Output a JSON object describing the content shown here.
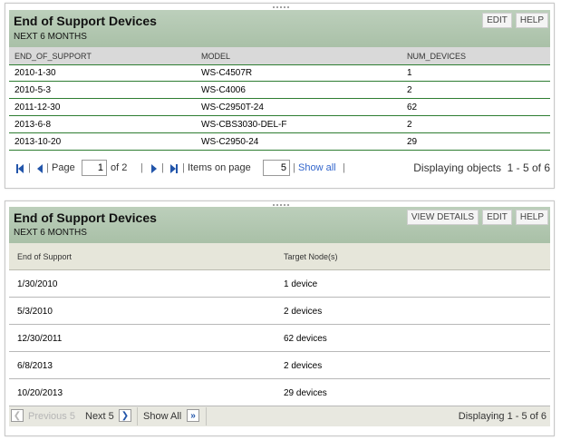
{
  "panel1": {
    "title": "End of Support Devices",
    "subtitle": "NEXT 6 MONTHS",
    "buttons": {
      "edit": "EDIT",
      "help": "HELP"
    },
    "columns": [
      "END_OF_SUPPORT",
      "MODEL",
      "NUM_DEVICES"
    ],
    "rows": [
      [
        "2010-1-30",
        "WS-C4507R",
        "1"
      ],
      [
        "2010-5-3",
        "WS-C4006",
        "2"
      ],
      [
        "2011-12-30",
        "WS-C2950T-24",
        "62"
      ],
      [
        "2013-6-8",
        "WS-CBS3030-DEL-F",
        "2"
      ],
      [
        "2013-10-20",
        "WS-C2950-24",
        "29"
      ]
    ],
    "pager": {
      "page_label": "Page",
      "page_value": "1",
      "of_label": "of 2",
      "items_label": "Items on page",
      "items_value": "5",
      "show_all": "Show all",
      "display_text": "Displaying objects  1 - 5 of 6"
    }
  },
  "panel2": {
    "title": "End of Support Devices",
    "subtitle": "NEXT 6 MONTHS",
    "buttons": {
      "view_details": "VIEW DETAILS",
      "edit": "EDIT",
      "help": "HELP"
    },
    "columns": [
      "End of Support",
      "Target Node(s)"
    ],
    "rows": [
      [
        "1/30/2010",
        "1 device"
      ],
      [
        "5/3/2010",
        "2 devices"
      ],
      [
        "12/30/2011",
        "62 devices"
      ],
      [
        "6/8/2013",
        "2 devices"
      ],
      [
        "10/20/2013",
        "29 devices"
      ]
    ],
    "footer": {
      "previous": "Previous 5",
      "next": "Next 5",
      "show_all": "Show All",
      "display_text": "Displaying 1 - 5 of 6"
    }
  },
  "colors": {
    "header_bg": "#b3c9b1",
    "row_border": "#2e7d32",
    "link": "#3366cc",
    "arrow": "#2255aa"
  }
}
